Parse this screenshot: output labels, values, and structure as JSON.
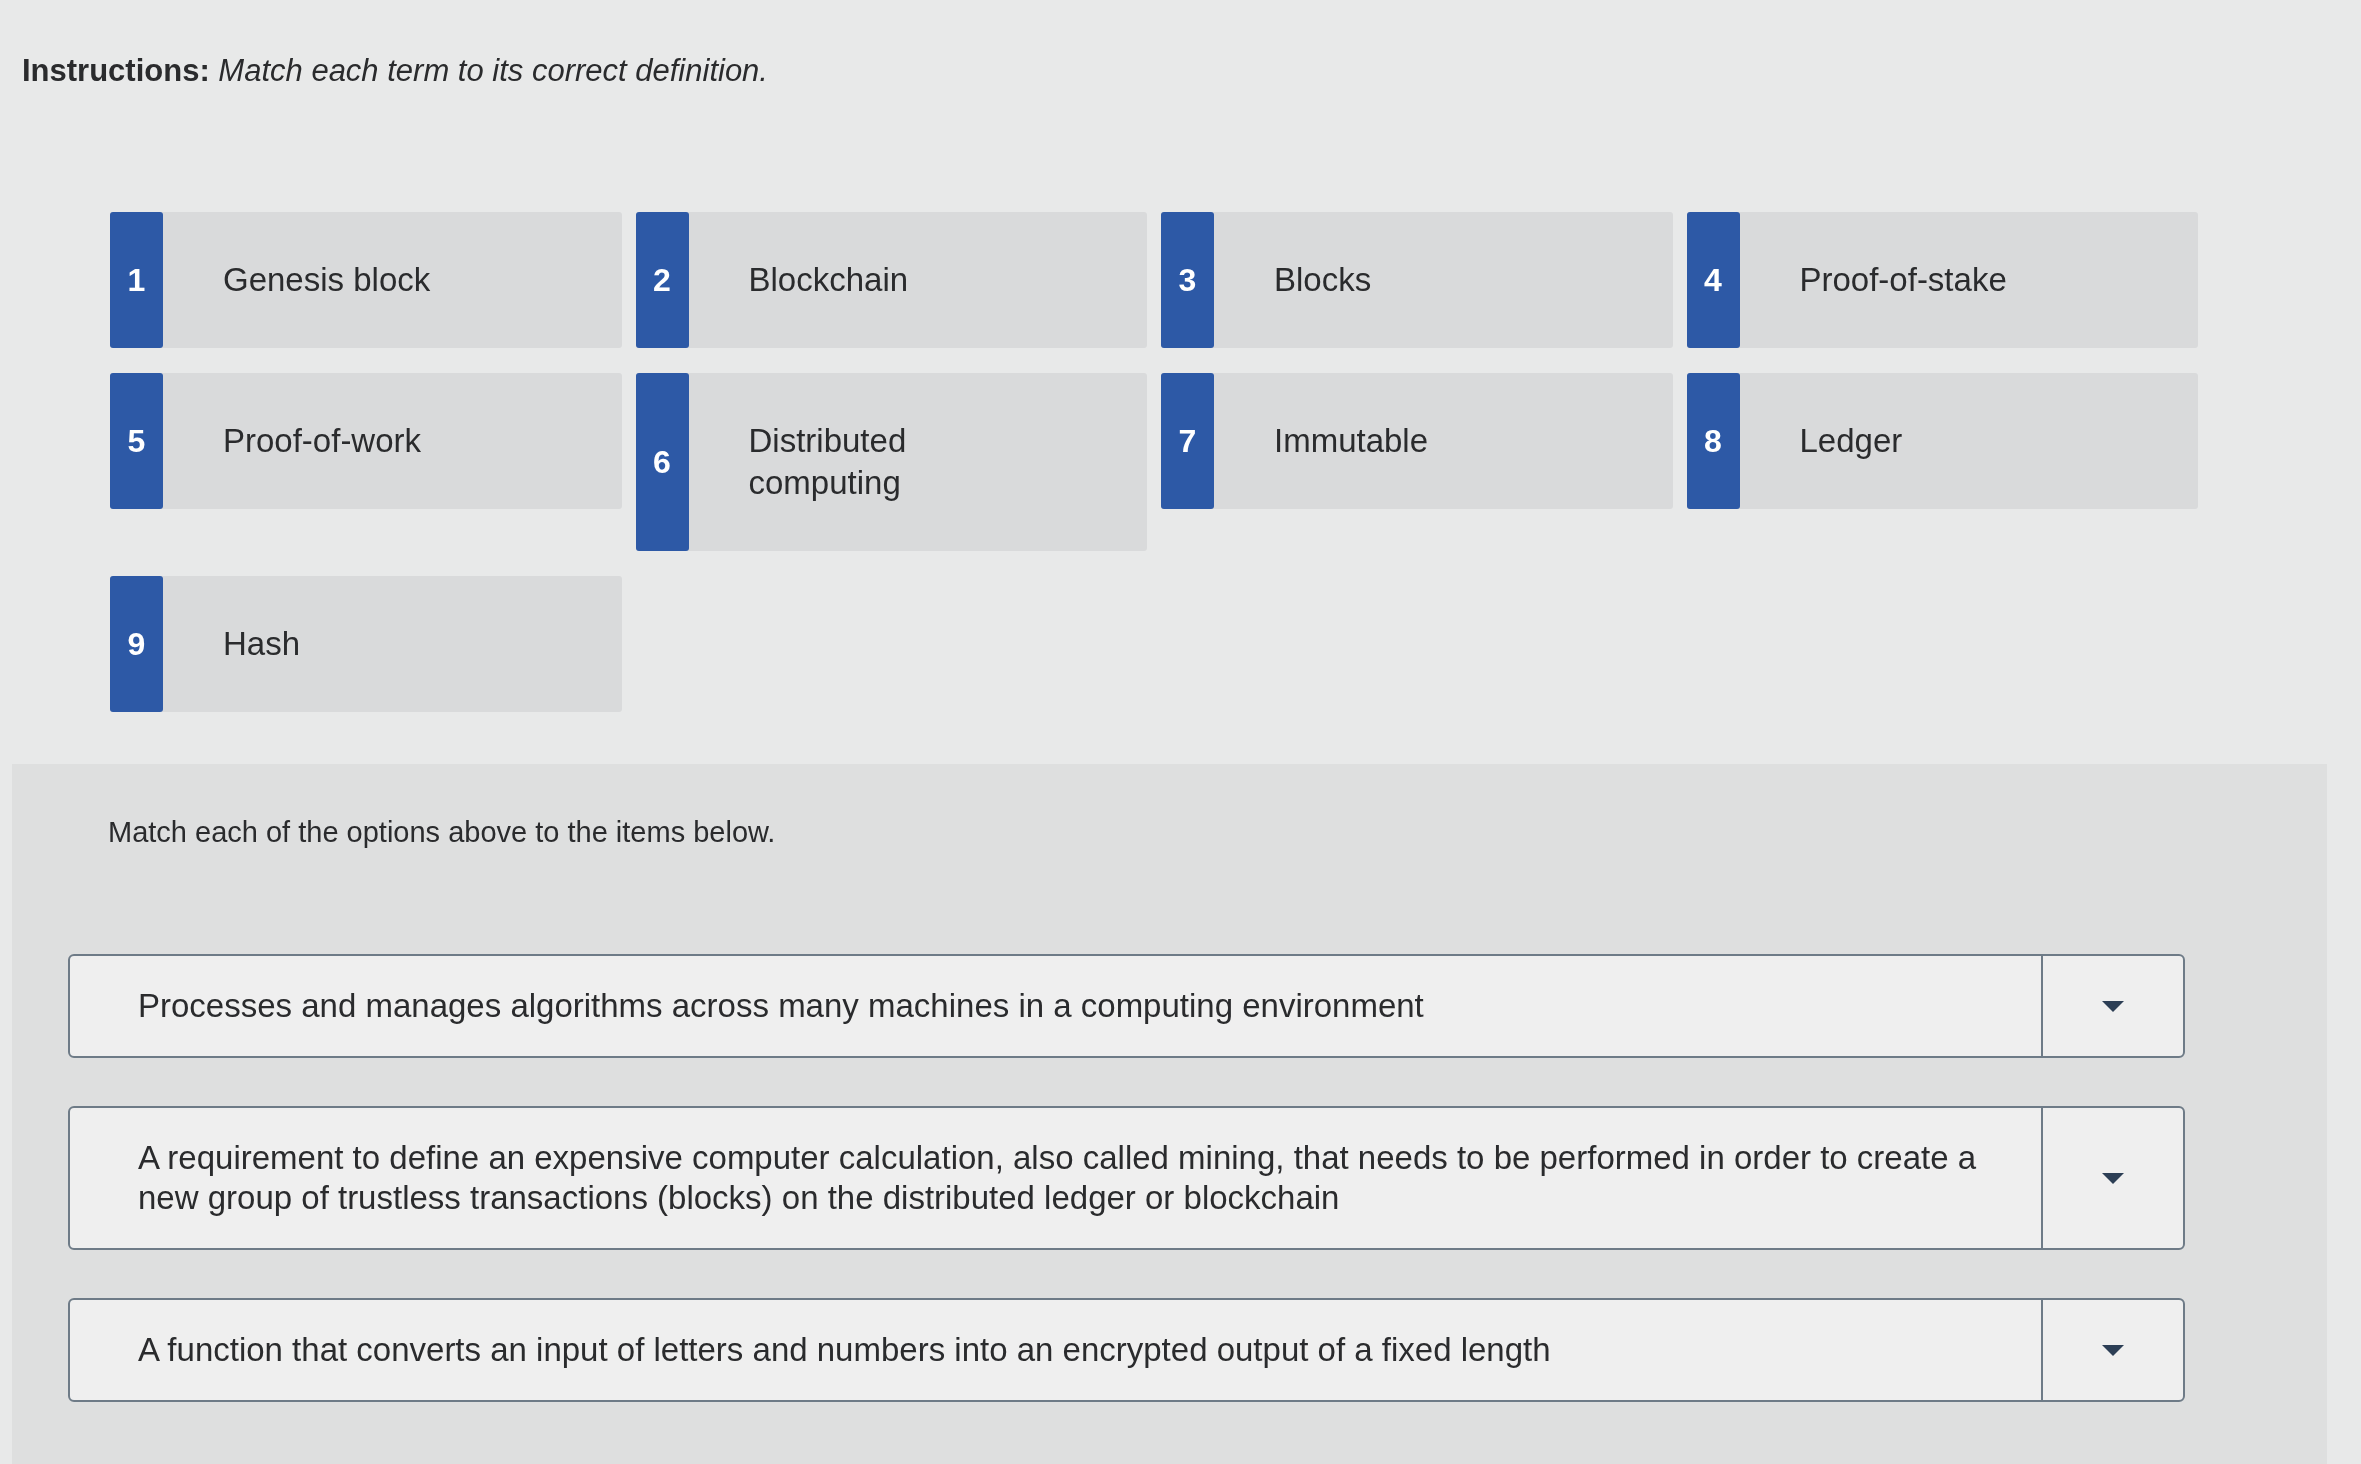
{
  "instructions": {
    "text": "**Instructions:** *Match each term to its correct definition.*"
  },
  "options": [
    {
      "number": "1",
      "term": "Genesis block"
    },
    {
      "number": "2",
      "term": "Blockchain"
    },
    {
      "number": "3",
      "term": "Blocks"
    },
    {
      "number": "4",
      "term": "Proof-of-stake"
    },
    {
      "number": "5",
      "term": "Proof-of-work"
    },
    {
      "number": "6",
      "term": "Distributed computing"
    },
    {
      "number": "7",
      "term": "Immutable"
    },
    {
      "number": "8",
      "term": "Ledger"
    },
    {
      "number": "9",
      "term": "Hash"
    }
  ],
  "match_panel": {
    "prompt": "Match each of the options above to the items below.",
    "items": [
      {
        "definition": "Processes and manages algorithms across many machines in a computing environment"
      },
      {
        "definition": "A requirement to define an expensive computer calculation, also called mining, that needs to be performed in order to create a new group of trustless transactions (blocks) on the distributed ledger or blockchain"
      },
      {
        "definition": "A function that converts an input of letters and numbers into an encrypted output of a fixed length"
      }
    ]
  }
}
